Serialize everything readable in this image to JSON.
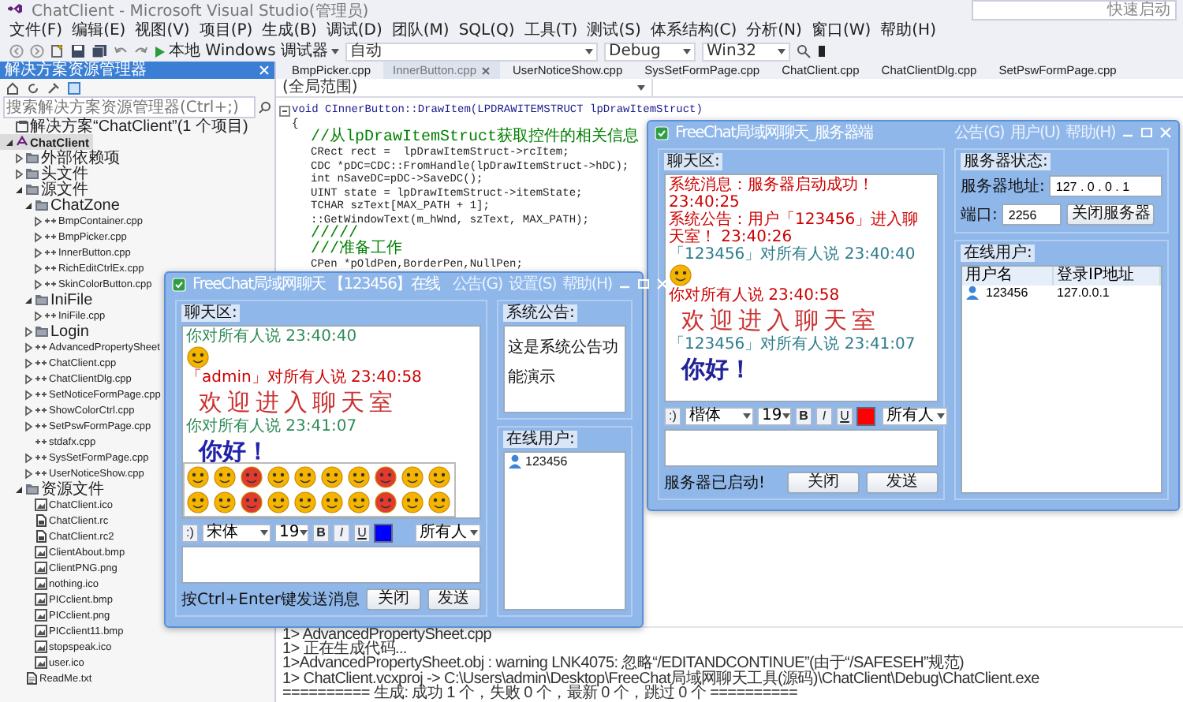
{
  "window": {
    "title": "ChatClient - Microsoft Visual Studio(管理员)",
    "quick_launch": {
      "placeholder": "快速启动"
    }
  },
  "menu": [
    "文件(F)",
    "编辑(E)",
    "视图(V)",
    "项目(P)",
    "生成(B)",
    "调试(D)",
    "团队(M)",
    "SQL(Q)",
    "工具(T)",
    "测试(S)",
    "体系结构(C)",
    "分析(N)",
    "窗口(W)",
    "帮助(H)"
  ],
  "toolbar": {
    "run_label": "本地 Windows 调试器",
    "launch": "自动",
    "config": "Debug",
    "platform": "Win32"
  },
  "solution_explorer": {
    "title": "解决方案资源管理器",
    "search": {
      "placeholder": "搜索解决方案资源管理器(Ctrl+;)"
    },
    "tree": [
      {
        "label": "解决方案“ChatClient”(1 个项目)",
        "kind": "solution",
        "selected": false,
        "children": [
          {
            "label": "ChatClient",
            "kind": "project",
            "selected": true,
            "expanded": true,
            "children": [
              {
                "label": "外部依赖项",
                "kind": "filter",
                "selected": false,
                "expanded": false
              },
              {
                "label": "头文件",
                "kind": "filter",
                "selected": false,
                "expanded": false
              },
              {
                "label": "源文件",
                "kind": "filter",
                "selected": false,
                "expanded": true,
                "children": [
                  {
                    "label": "ChatZone",
                    "kind": "filter",
                    "selected": false,
                    "expanded": true,
                    "children": [
                      {
                        "label": "BmpContainer.cpp",
                        "kind": "cpp",
                        "selected": false,
                        "expanded": false
                      },
                      {
                        "label": "BmpPicker.cpp",
                        "kind": "cpp",
                        "selected": false,
                        "expanded": false
                      },
                      {
                        "label": "InnerButton.cpp",
                        "kind": "cpp",
                        "selected": false,
                        "expanded": false
                      },
                      {
                        "label": "RichEditCtrlEx.cpp",
                        "kind": "cpp",
                        "selected": false,
                        "expanded": false
                      },
                      {
                        "label": "SkinColorButton.cpp",
                        "kind": "cpp",
                        "selected": false,
                        "expanded": false
                      }
                    ]
                  },
                  {
                    "label": "IniFile",
                    "kind": "filter",
                    "selected": false,
                    "expanded": true,
                    "children": [
                      {
                        "label": "IniFile.cpp",
                        "kind": "cpp",
                        "selected": false,
                        "expanded": false
                      }
                    ]
                  },
                  {
                    "label": "Login",
                    "kind": "filter",
                    "selected": false,
                    "expanded": false
                  },
                  {
                    "label": "AdvancedPropertySheet",
                    "kind": "cpp",
                    "selected": false,
                    "expanded": false
                  },
                  {
                    "label": "ChatClient.cpp",
                    "kind": "cpp",
                    "selected": false,
                    "expanded": false
                  },
                  {
                    "label": "ChatClientDlg.cpp",
                    "kind": "cpp",
                    "selected": false,
                    "expanded": false
                  },
                  {
                    "label": "SetNoticeFormPage.cpp",
                    "kind": "cpp",
                    "selected": false,
                    "expanded": false
                  },
                  {
                    "label": "ShowColorCtrl.cpp",
                    "kind": "cpp",
                    "selected": false,
                    "expanded": false
                  },
                  {
                    "label": "SetPswFormPage.cpp",
                    "kind": "cpp",
                    "selected": false,
                    "expanded": false
                  },
                  {
                    "label": "stdafx.cpp",
                    "kind": "cpp",
                    "selected": false
                  },
                  {
                    "label": "SysSetFormPage.cpp",
                    "kind": "cpp",
                    "selected": false,
                    "expanded": false
                  },
                  {
                    "label": "UserNoticeShow.cpp",
                    "kind": "cpp",
                    "selected": false,
                    "expanded": false
                  }
                ]
              },
              {
                "label": "资源文件",
                "kind": "filter",
                "selected": false,
                "expanded": true,
                "children": [
                  {
                    "label": "ChatClient.ico",
                    "kind": "image",
                    "selected": false
                  },
                  {
                    "label": "ChatClient.rc",
                    "kind": "rc",
                    "selected": false
                  },
                  {
                    "label": "ChatClient.rc2",
                    "kind": "rc",
                    "selected": false
                  },
                  {
                    "label": "ClientAbout.bmp",
                    "kind": "image",
                    "selected": false
                  },
                  {
                    "label": "ClientPNG.png",
                    "kind": "image",
                    "selected": false
                  },
                  {
                    "label": "nothing.ico",
                    "kind": "image",
                    "selected": false
                  },
                  {
                    "label": "PICclient.bmp",
                    "kind": "image",
                    "selected": false
                  },
                  {
                    "label": "PICclient.png",
                    "kind": "image",
                    "selected": false
                  },
                  {
                    "label": "PICclient11.bmp",
                    "kind": "image",
                    "selected": false
                  },
                  {
                    "label": "stopspeak.ico",
                    "kind": "image",
                    "selected": false
                  },
                  {
                    "label": "user.ico",
                    "kind": "image",
                    "selected": false
                  }
                ]
              },
              {
                "label": "ReadMe.txt",
                "kind": "text",
                "selected": false
              }
            ]
          }
        ]
      }
    ]
  },
  "editor": {
    "tabs": [
      {
        "label": "BmpPicker.cpp",
        "selected": false
      },
      {
        "label": "InnerButton.cpp",
        "selected": true
      },
      {
        "label": "UserNoticeShow.cpp",
        "selected": false
      },
      {
        "label": "SysSetFormPage.cpp",
        "selected": false
      },
      {
        "label": "ChatClient.cpp",
        "selected": false
      },
      {
        "label": "ChatClientDlg.cpp",
        "selected": false
      },
      {
        "label": "SetPswFormPage.cpp",
        "selected": false
      }
    ],
    "scope": "(全局范围)",
    "code": [
      {
        "kind": "signature",
        "text": "void CInnerButton::DrawItem(LPDRAWITEMSTRUCT lpDrawItemStruct)"
      },
      {
        "kind": "brace",
        "text": "{"
      },
      {
        "kind": "comment",
        "text": "//从lpDrawItemStruct获取控件的相关信息"
      },
      {
        "kind": "statement",
        "text": "CRect rect =  lpDrawItemStruct->rcItem;"
      },
      {
        "kind": "statement",
        "text": "CDC *pDC=CDC::FromHandle(lpDrawItemStruct->hDC);"
      },
      {
        "kind": "statement",
        "text": "int nSaveDC=pDC->SaveDC();"
      },
      {
        "kind": "statement",
        "text": "UINT state = lpDrawItemStruct->itemState;"
      },
      {
        "kind": "statement",
        "text": "TCHAR szText[MAX_PATH + 1];"
      },
      {
        "kind": "statement",
        "text": "::GetWindowText(m_hWnd, szText, MAX_PATH);"
      },
      {
        "kind": "comment",
        "text": "/////"
      },
      {
        "kind": "comment",
        "text": "///准备工作"
      },
      {
        "kind": "statement",
        "text": "CPen *pOldPen,BorderPen,NullPen;"
      }
    ]
  },
  "output": {
    "lines": [
      "1>  AdvancedPropertySheet.cpp",
      "1>  正在生成代码...",
      "1>AdvancedPropertySheet.obj : warning LNK4075: 忽略“/EDITANDCONTINUE”(由于“/SAFESEH”规范)",
      "1>  ChatClient.vcxproj -> C:\\Users\\admin\\Desktop\\FreeChat局域网聊天工具(源码)\\ChatClient\\Debug\\ChatClient.exe",
      "========== 生成: 成功 1 个，失败 0 个，最新 0 个，跳过 0 个 =========="
    ]
  },
  "client_dialog": {
    "title": "FreeChat局域网聊天 【123456】在线",
    "menus": [
      "公告(G)",
      "设置(S)",
      "帮助(H)"
    ],
    "chat_label": "聊天区:",
    "messages": [
      {
        "kind": "line",
        "text": "你对所有人说 23:40:40",
        "color": "#2e8b57"
      },
      {
        "kind": "emoticon"
      },
      {
        "kind": "line",
        "text": "「admin」对所有人说 23:40:58",
        "color": "#cc0000"
      },
      {
        "kind": "large_script",
        "text": "欢迎进入聊天室",
        "color": "#cc3333"
      },
      {
        "kind": "line",
        "text": "你对所有人说 23:41:07",
        "color": "#2e8b57"
      },
      {
        "kind": "large_bold",
        "text": "你好！",
        "color": "#2222aa"
      }
    ],
    "emoticons_open": true,
    "toolbar": {
      "smiley": ":)",
      "font": "宋体",
      "size": "19",
      "bold": "B",
      "italic": "I",
      "underline": "U",
      "recipient": "所有人"
    },
    "hint": "按Ctrl+Enter键发送消息",
    "buttons": [
      "关闭",
      "发送"
    ],
    "notice_label": "系统公告:",
    "notice_text": "这是系统公告功能演示",
    "users_label": "在线用户:",
    "users": [
      "123456"
    ]
  },
  "server_dialog": {
    "title": "FreeChat局域网聊天_服务器端",
    "menus": [
      "公告(G)",
      "用户(U)",
      "帮助(H)"
    ],
    "chat_label": "聊天区:",
    "messages": [
      {
        "kind": "line",
        "text": "系统消息：服务器启动成功！ 23:40:25",
        "color": "#cc0000"
      },
      {
        "kind": "line",
        "text": "系统公告：用户「123456」进入聊天室！ 23:40:26",
        "color": "#cc0000"
      },
      {
        "kind": "line",
        "text": "「123456」对所有人说 23:40:40",
        "color": "#2e7d8b"
      },
      {
        "kind": "emoticon"
      },
      {
        "kind": "line",
        "text": "你对所有人说 23:40:58",
        "color": "#cc0000"
      },
      {
        "kind": "large_script",
        "text": "欢迎进入聊天室",
        "color": "#cc3333"
      },
      {
        "kind": "line",
        "text": "「123456」对所有人说 23:41:07",
        "color": "#2e7d8b"
      },
      {
        "kind": "large_bold",
        "text": "你好！",
        "color": "#222299"
      }
    ],
    "toolbar": {
      "smiley": ":)",
      "font": "楷体",
      "size": "19",
      "bold": "B",
      "italic": "I",
      "underline": "U",
      "recipient": "所有人"
    },
    "status": "服务器已启动!",
    "buttons": [
      "关闭",
      "发送"
    ],
    "server_label": "服务器状态:",
    "address_label": "服务器地址:",
    "address": "127 . 0 . 0 . 1",
    "port_label": "端口:",
    "port": "2256",
    "stop_button": "关闭服务器",
    "users_label": "在线用户:",
    "columns": [
      "用户名",
      "登录IP地址"
    ],
    "users": [
      {
        "name": "123456",
        "ip": "127.0.0.1"
      }
    ]
  }
}
